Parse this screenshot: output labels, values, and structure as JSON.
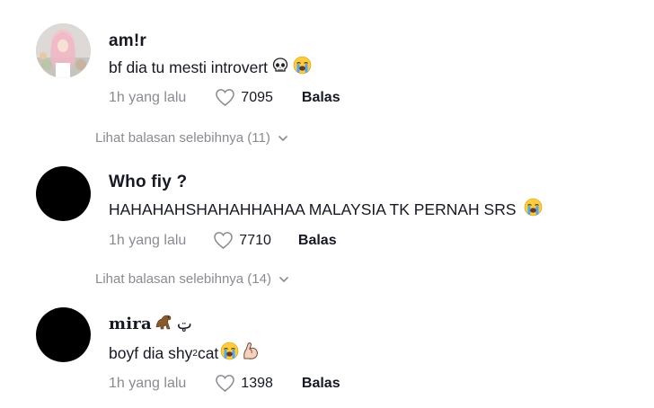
{
  "comments": [
    {
      "username": "am!r",
      "text": "bf dia tu mesti introvert",
      "emojis": [
        "skull-emoji",
        "crying-face-emoji"
      ],
      "time": "1h yang lalu",
      "likes": "7095",
      "reply_label": "Balas",
      "view_replies": "Lihat balasan selebihnya (11)"
    },
    {
      "username": "Who fiy ?",
      "text": "HAHAHAHSHAHAHHAHAA MALAYSIA TK PERNAH SRS",
      "emojis": [
        "crying-face-emoji"
      ],
      "time": "1h yang lalu",
      "likes": "7710",
      "reply_label": "Balas",
      "view_replies": "Lihat balasan selebihnya (14)"
    },
    {
      "username": "mira",
      "username_suffix": "ټ",
      "text_before": "boyf dia shy",
      "text_sup": "2",
      "text_after": " cat",
      "emojis": [
        "crying-face-emoji",
        "flexed-biceps-emoji"
      ],
      "time": "1h yang lalu",
      "likes": "1398",
      "reply_label": "Balas"
    }
  ],
  "colors": {
    "primary_text": "#161823",
    "secondary_text": "#8a8b91",
    "background": "#ffffff"
  }
}
